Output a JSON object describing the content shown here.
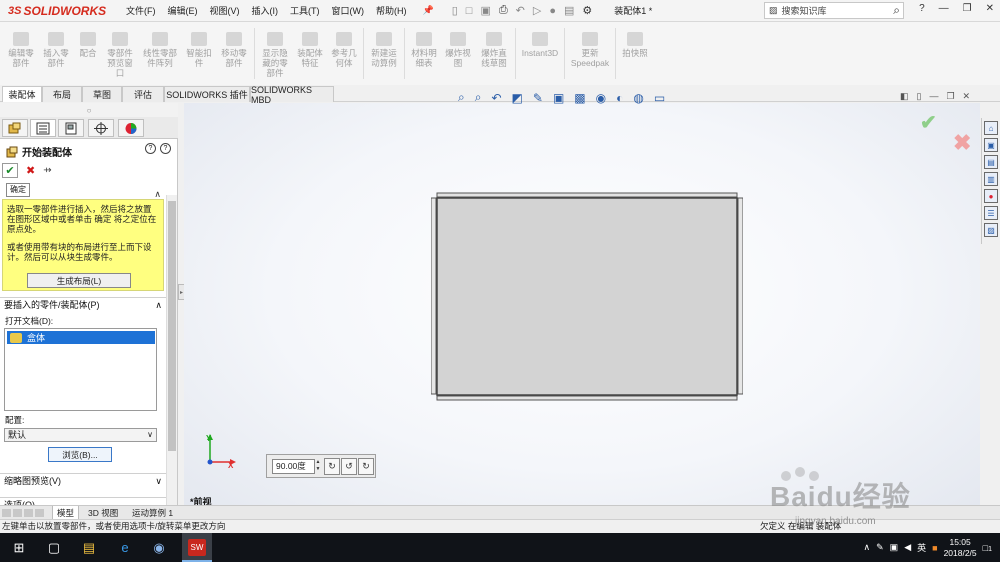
{
  "app": {
    "brand": "SOLIDWORKS",
    "document_title": "装配体1 *",
    "menu": [
      "文件(F)",
      "编辑(E)",
      "视图(V)",
      "插入(I)",
      "工具(T)",
      "窗口(W)",
      "帮助(H)"
    ],
    "search_placeholder": "搜索知识库"
  },
  "commands": [
    {
      "label": "编辑零\n部件"
    },
    {
      "label": "插入零\n部件"
    },
    {
      "label": "配合"
    },
    {
      "label": "零部件\n预览窗\n口"
    },
    {
      "label": "线性零部\n件阵列"
    },
    {
      "label": "智能扣\n件"
    },
    {
      "label": "移动零\n部件"
    },
    {
      "label": "显示隐\n藏的零\n部件"
    },
    {
      "label": "装配体\n特征"
    },
    {
      "label": "参考几\n何体"
    },
    {
      "label": "新建运\n动算例"
    },
    {
      "label": "材料明\n细表"
    },
    {
      "label": "爆炸视\n图"
    },
    {
      "label": "爆炸直\n线草图"
    },
    {
      "label": "Instant3D"
    },
    {
      "label": "更新\nSpeedpak"
    },
    {
      "label": "拍快照"
    }
  ],
  "tabs": [
    "装配体",
    "布局",
    "草图",
    "评估",
    "SOLIDWORKS 插件",
    "SOLIDWORKS MBD"
  ],
  "property_manager": {
    "title": "开始装配体",
    "help_icons": [
      "?",
      "?"
    ],
    "tooltip": "确定",
    "message": {
      "p1": "选取一零部件进行插入，然后将之放置在图形区域中或者单击 确定 将之定位在原点处。",
      "p2": "或者使用带有块的布局进行至上而下设计。然后可以从块生成零件。"
    },
    "create_layout_button": "生成布局(L)",
    "insert_group": "要插入的零件/装配体(P)",
    "open_docs_label": "打开文档(D):",
    "open_docs": [
      "盒体"
    ],
    "config_label": "配置:",
    "config_value": "默认",
    "browse_button": "浏览(B)...",
    "thumbnail_group": "缩略图预览(V)",
    "options_group": "选项(O)"
  },
  "viewport": {
    "rotation_value": "90.00度",
    "view_name": "*前视"
  },
  "bottom_tabs": [
    "模型",
    "3D 视图",
    "运动算例 1"
  ],
  "status": {
    "text": "左键单击以放置零部件，或者使用选项卡/旋转菜单更改方向",
    "right_text": "欠定义 在编辑 装配体",
    "clock_time": "15:05",
    "clock_date": "2018/2/5",
    "ime": "英",
    "notif_count": "1"
  },
  "watermark": {
    "text": "Baidu经验",
    "sub": "jingyan.baidu.com"
  }
}
